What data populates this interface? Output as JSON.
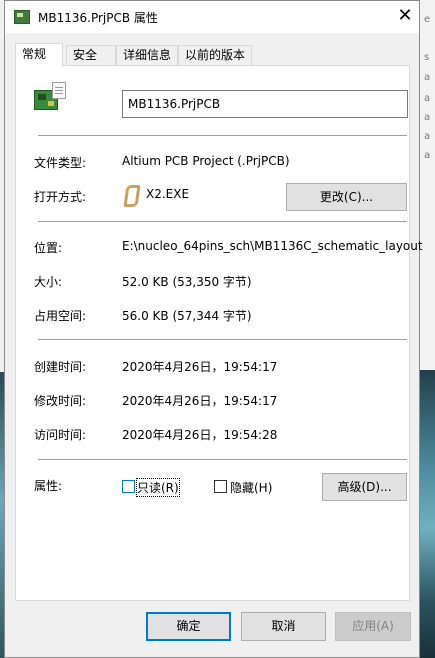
{
  "window": {
    "title": "MB1136.PrjPCB 属性",
    "close_glyph": "✕"
  },
  "tabs": [
    {
      "label": "常规",
      "active": true
    },
    {
      "label": "安全",
      "active": false
    },
    {
      "label": "详细信息",
      "active": false
    },
    {
      "label": "以前的版本",
      "active": false
    }
  ],
  "general": {
    "file_name": "MB1136.PrjPCB",
    "file_type_label": "文件类型:",
    "file_type_value": "Altium PCB Project (.PrjPCB)",
    "open_with_label": "打开方式:",
    "open_with_value": "X2.EXE",
    "change_button": "更改(C)...",
    "location_label": "位置:",
    "location_value": "E:\\nucleo_64pins_sch\\MB1136C_schematic_layout",
    "size_label": "大小:",
    "size_value": "52.0 KB (53,350 字节)",
    "size_on_disk_label": "占用空间:",
    "size_on_disk_value": "56.0 KB (57,344 字节)",
    "created_label": "创建时间:",
    "created_value": "2020年4月26日，19:54:17",
    "modified_label": "修改时间:",
    "modified_value": "2020年4月26日，19:54:17",
    "accessed_label": "访问时间:",
    "accessed_value": "2020年4月26日，19:54:28",
    "attributes_label": "属性:",
    "readonly_label": "只读(R)",
    "hidden_label": "隐藏(H)",
    "advanced_button": "高级(D)..."
  },
  "footer": {
    "ok": "确定",
    "cancel": "取消",
    "apply": "应用(A)"
  },
  "background_letters": [
    "e",
    "s",
    "a",
    "a",
    "a",
    "a",
    "a"
  ],
  "colors": {
    "accent": "#0078d7",
    "panel": "#ffffff",
    "window_bg": "#f0f0f0"
  }
}
